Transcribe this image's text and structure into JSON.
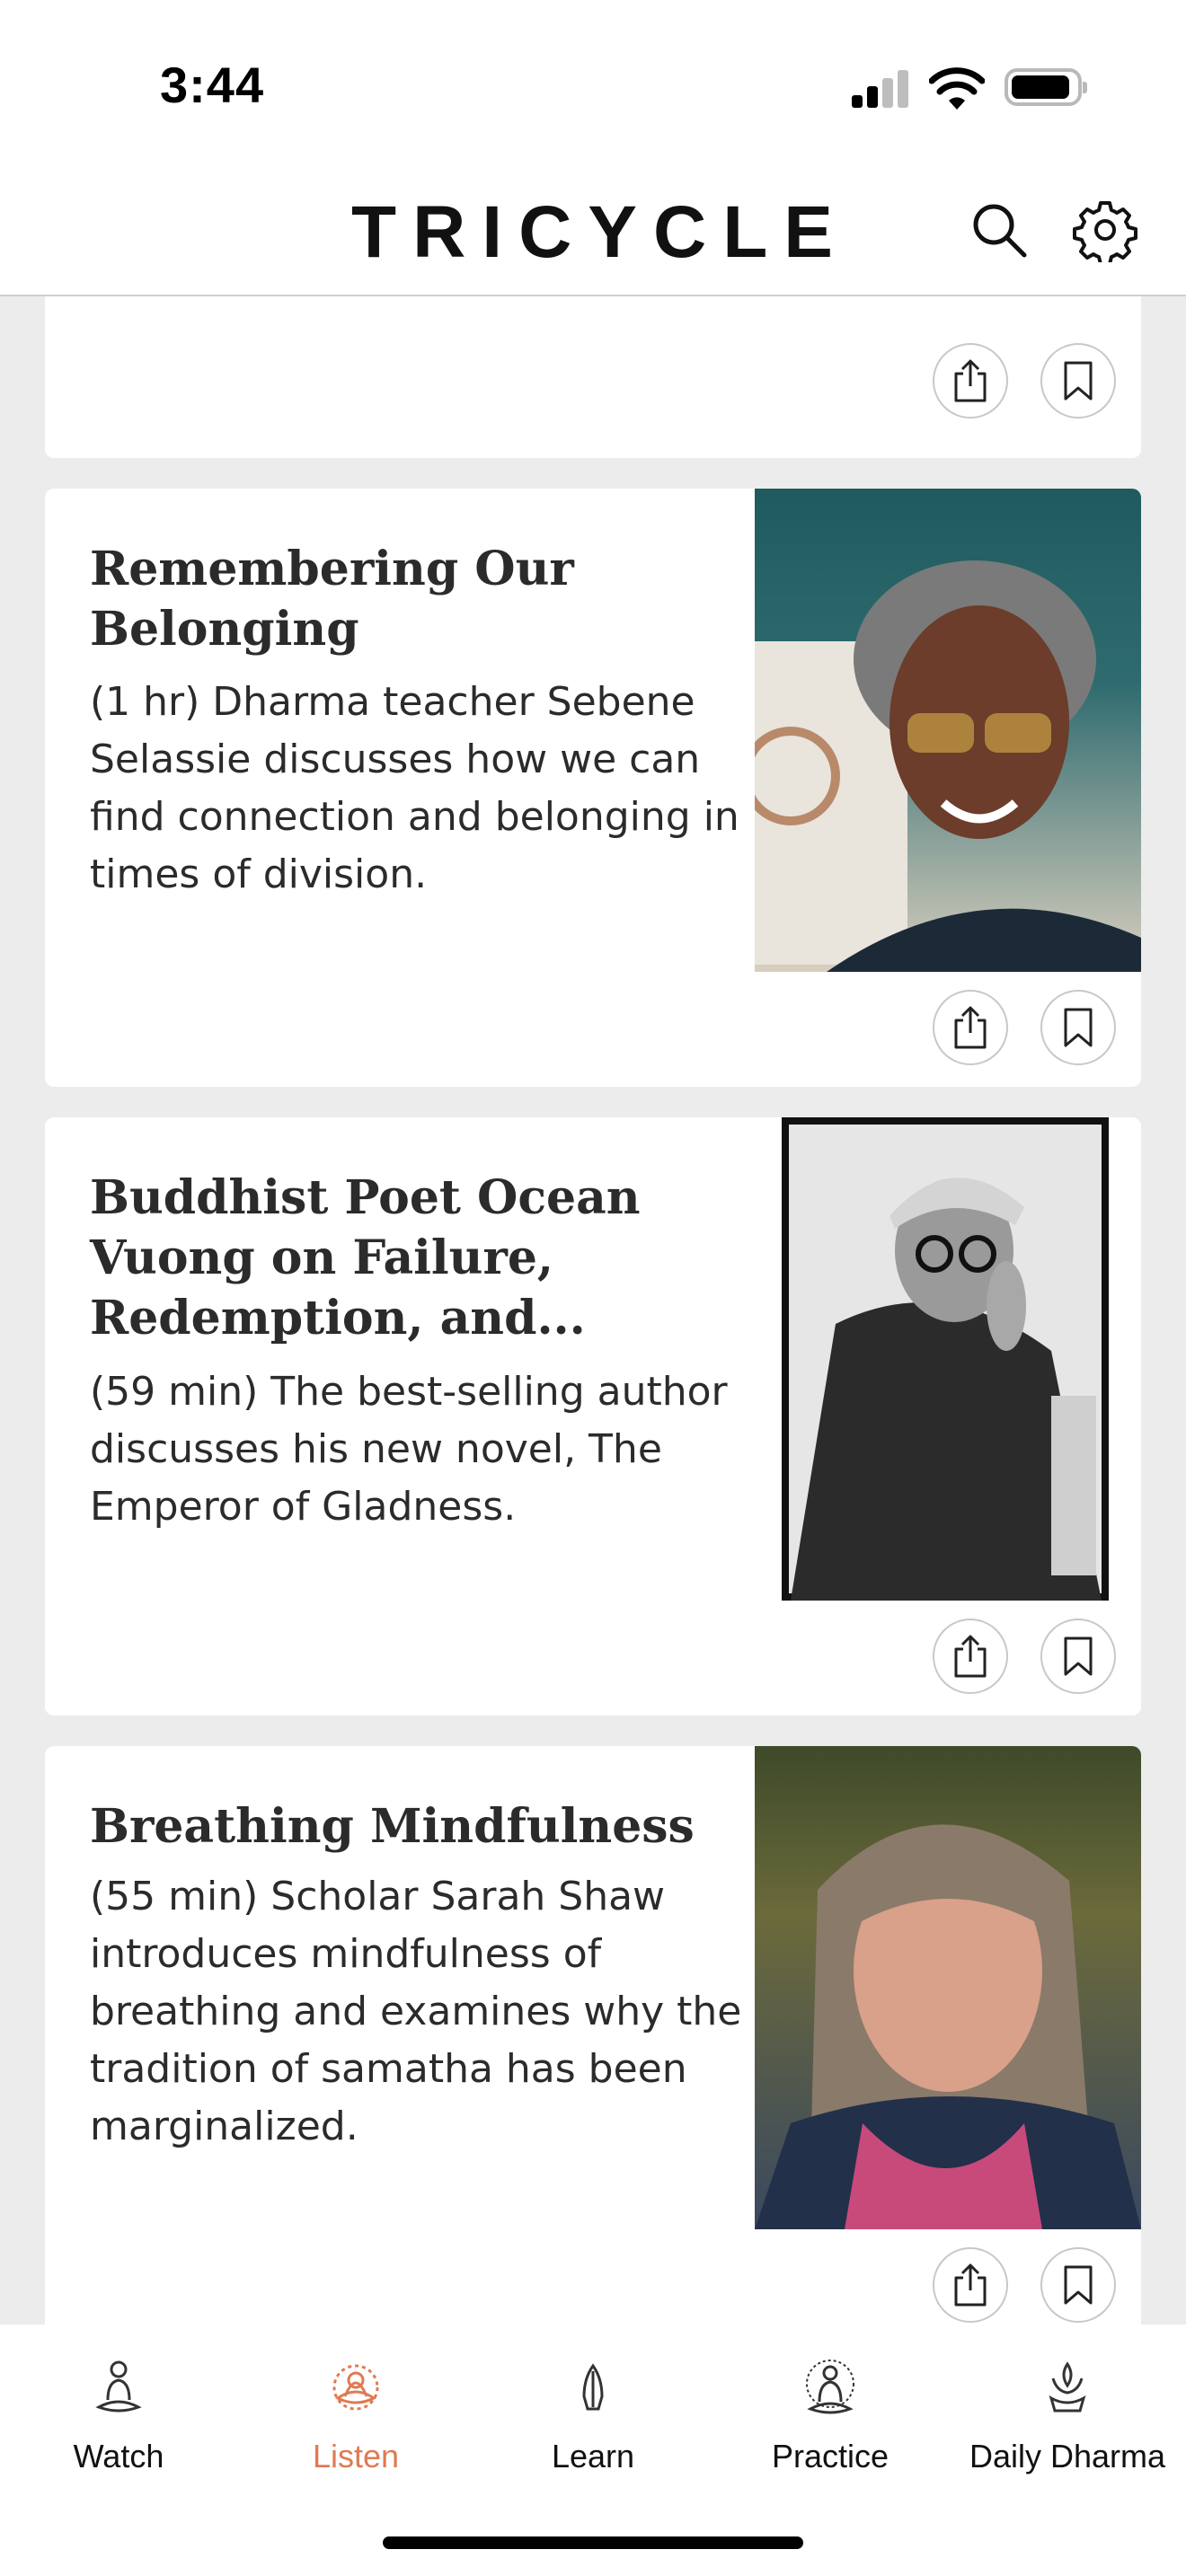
{
  "status_bar": {
    "time": "3:44"
  },
  "header": {
    "logo": "TRICYCLE",
    "search_icon": "search-icon",
    "settings_icon": "gear-icon"
  },
  "feed": {
    "items": [
      {
        "title": "Remembering Our Belonging",
        "description": "(1 hr) Dharma teacher Sebene Selassie discusses how we can find connection and belonging in times of division.",
        "image": "portrait of a smiling woman with gray curly hair and gold-tinted glasses"
      },
      {
        "title": "Buddhist Poet Ocean Vuong on Failure, Redemption, and...",
        "description": "(59 min) The best-selling author discusses his new novel, The Emperor of Gladness.",
        "image": "black and white portrait of a man in a cap and glasses"
      },
      {
        "title": "Breathing Mindfulness",
        "description": "(55 min) Scholar Sarah Shaw introduces mindfulness of breathing and examines why the tradition of samatha has been marginalized.",
        "image": "portrait of an older woman with long gray hair and a colorful scarf"
      }
    ],
    "actions": {
      "share_icon": "share-icon",
      "bookmark_icon": "bookmark-icon"
    }
  },
  "tabbar": {
    "tabs": [
      {
        "label": "Watch",
        "icon": "meditator-icon"
      },
      {
        "label": "Listen",
        "icon": "lotus-icon"
      },
      {
        "label": "Learn",
        "icon": "praying-hands-icon"
      },
      {
        "label": "Practice",
        "icon": "buddha-icon"
      },
      {
        "label": "Daily Dharma",
        "icon": "lotus-hand-icon"
      }
    ],
    "active_tab": "Listen"
  },
  "colors": {
    "accent": "#e07a52",
    "background": "#ececec",
    "card": "#ffffff",
    "text": "#2b2b2b"
  }
}
